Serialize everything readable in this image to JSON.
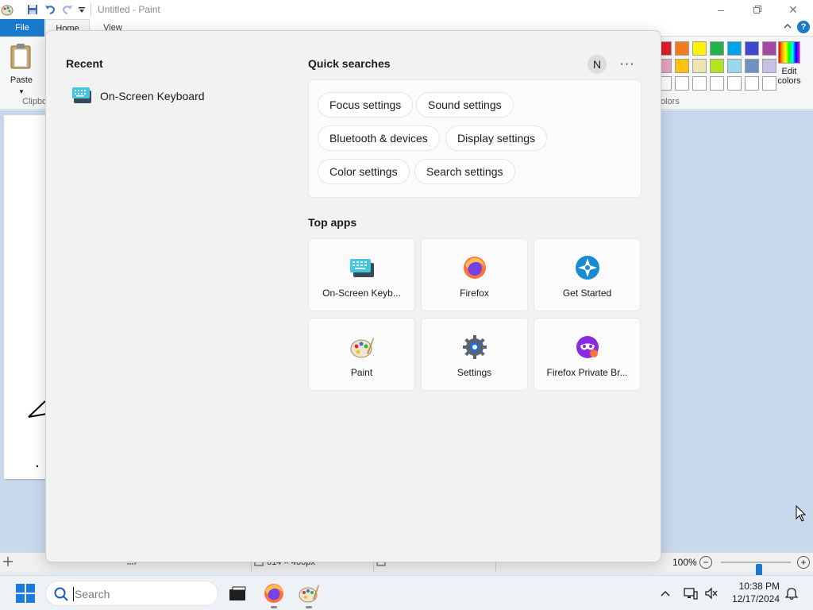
{
  "paint": {
    "title": "Untitled - Paint",
    "tabs": {
      "file": "File",
      "home": "Home",
      "view": "View"
    },
    "paste_label": "Paste",
    "clipboard_label": "Clipbo",
    "colors_label": "olors",
    "edit_colors_label": "Edit colors",
    "palette_row1": [
      "#e0202a",
      "#f47a20",
      "#fff200",
      "#22b14c",
      "#00a2e8",
      "#3f48cc",
      "#a349a4"
    ],
    "palette_row2": [
      "#e8a2c0",
      "#ffc20e",
      "#efe4b0",
      "#b5e61d",
      "#99d9ea",
      "#7092be",
      "#c8bfe7"
    ],
    "status": {
      "dimensions": "614 × 460px",
      "zoom": "100%"
    },
    "zoom_fraction": 0.5
  },
  "flyout": {
    "recent_title": "Recent",
    "recent_items": [
      {
        "label": "On-Screen Keyboard",
        "icon": "keyboard-icon"
      }
    ],
    "quick_title": "Quick searches",
    "avatar_letter": "N",
    "more_label": "···",
    "quick_searches": [
      "Focus settings",
      "Sound settings",
      "Bluetooth & devices",
      "Display settings",
      "Color settings",
      "Search settings"
    ],
    "top_apps_title": "Top apps",
    "top_apps": [
      {
        "name": "On-Screen Keyb...",
        "icon": "keyboard-icon"
      },
      {
        "name": "Firefox",
        "icon": "firefox-icon"
      },
      {
        "name": "Get Started",
        "icon": "get-started-icon"
      },
      {
        "name": "Paint",
        "icon": "paint-icon"
      },
      {
        "name": "Settings",
        "icon": "settings-icon"
      },
      {
        "name": "Firefox Private Br...",
        "icon": "firefox-private-icon"
      }
    ]
  },
  "taskbar": {
    "search_placeholder": "Search",
    "time": "10:38 PM",
    "date": "12/17/2024",
    "pinned": [
      "file-explorer-icon",
      "firefox-icon",
      "paint-icon"
    ]
  }
}
